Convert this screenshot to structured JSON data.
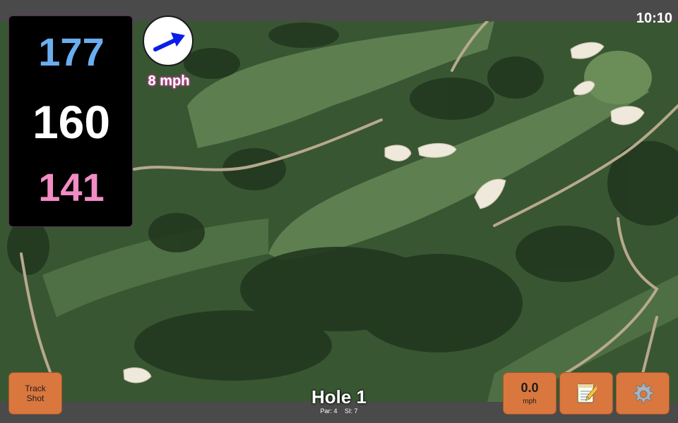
{
  "clock": "10:10",
  "distances": {
    "back": "177",
    "middle": "160",
    "front": "141"
  },
  "wind": {
    "speed_label": "8 mph",
    "direction_icon": "wind-arrow-icon"
  },
  "track_button": {
    "label_line1": "Track",
    "label_line2": "Shot"
  },
  "speed_button": {
    "value": "0.0",
    "unit": "mph"
  },
  "notes_button": {
    "icon": "notepad-icon"
  },
  "settings_button": {
    "icon": "gear-icon"
  },
  "hole": {
    "title": "Hole 1",
    "par": "Par: 4",
    "si": "SI: 7"
  },
  "colors": {
    "back_distance": "#6aaef0",
    "middle_distance": "#ffffff",
    "front_distance": "#f28cc4",
    "button_orange": "#d9773e",
    "wind_arrow": "#0a1ee8",
    "bar_gray": "#4a4a4a"
  }
}
